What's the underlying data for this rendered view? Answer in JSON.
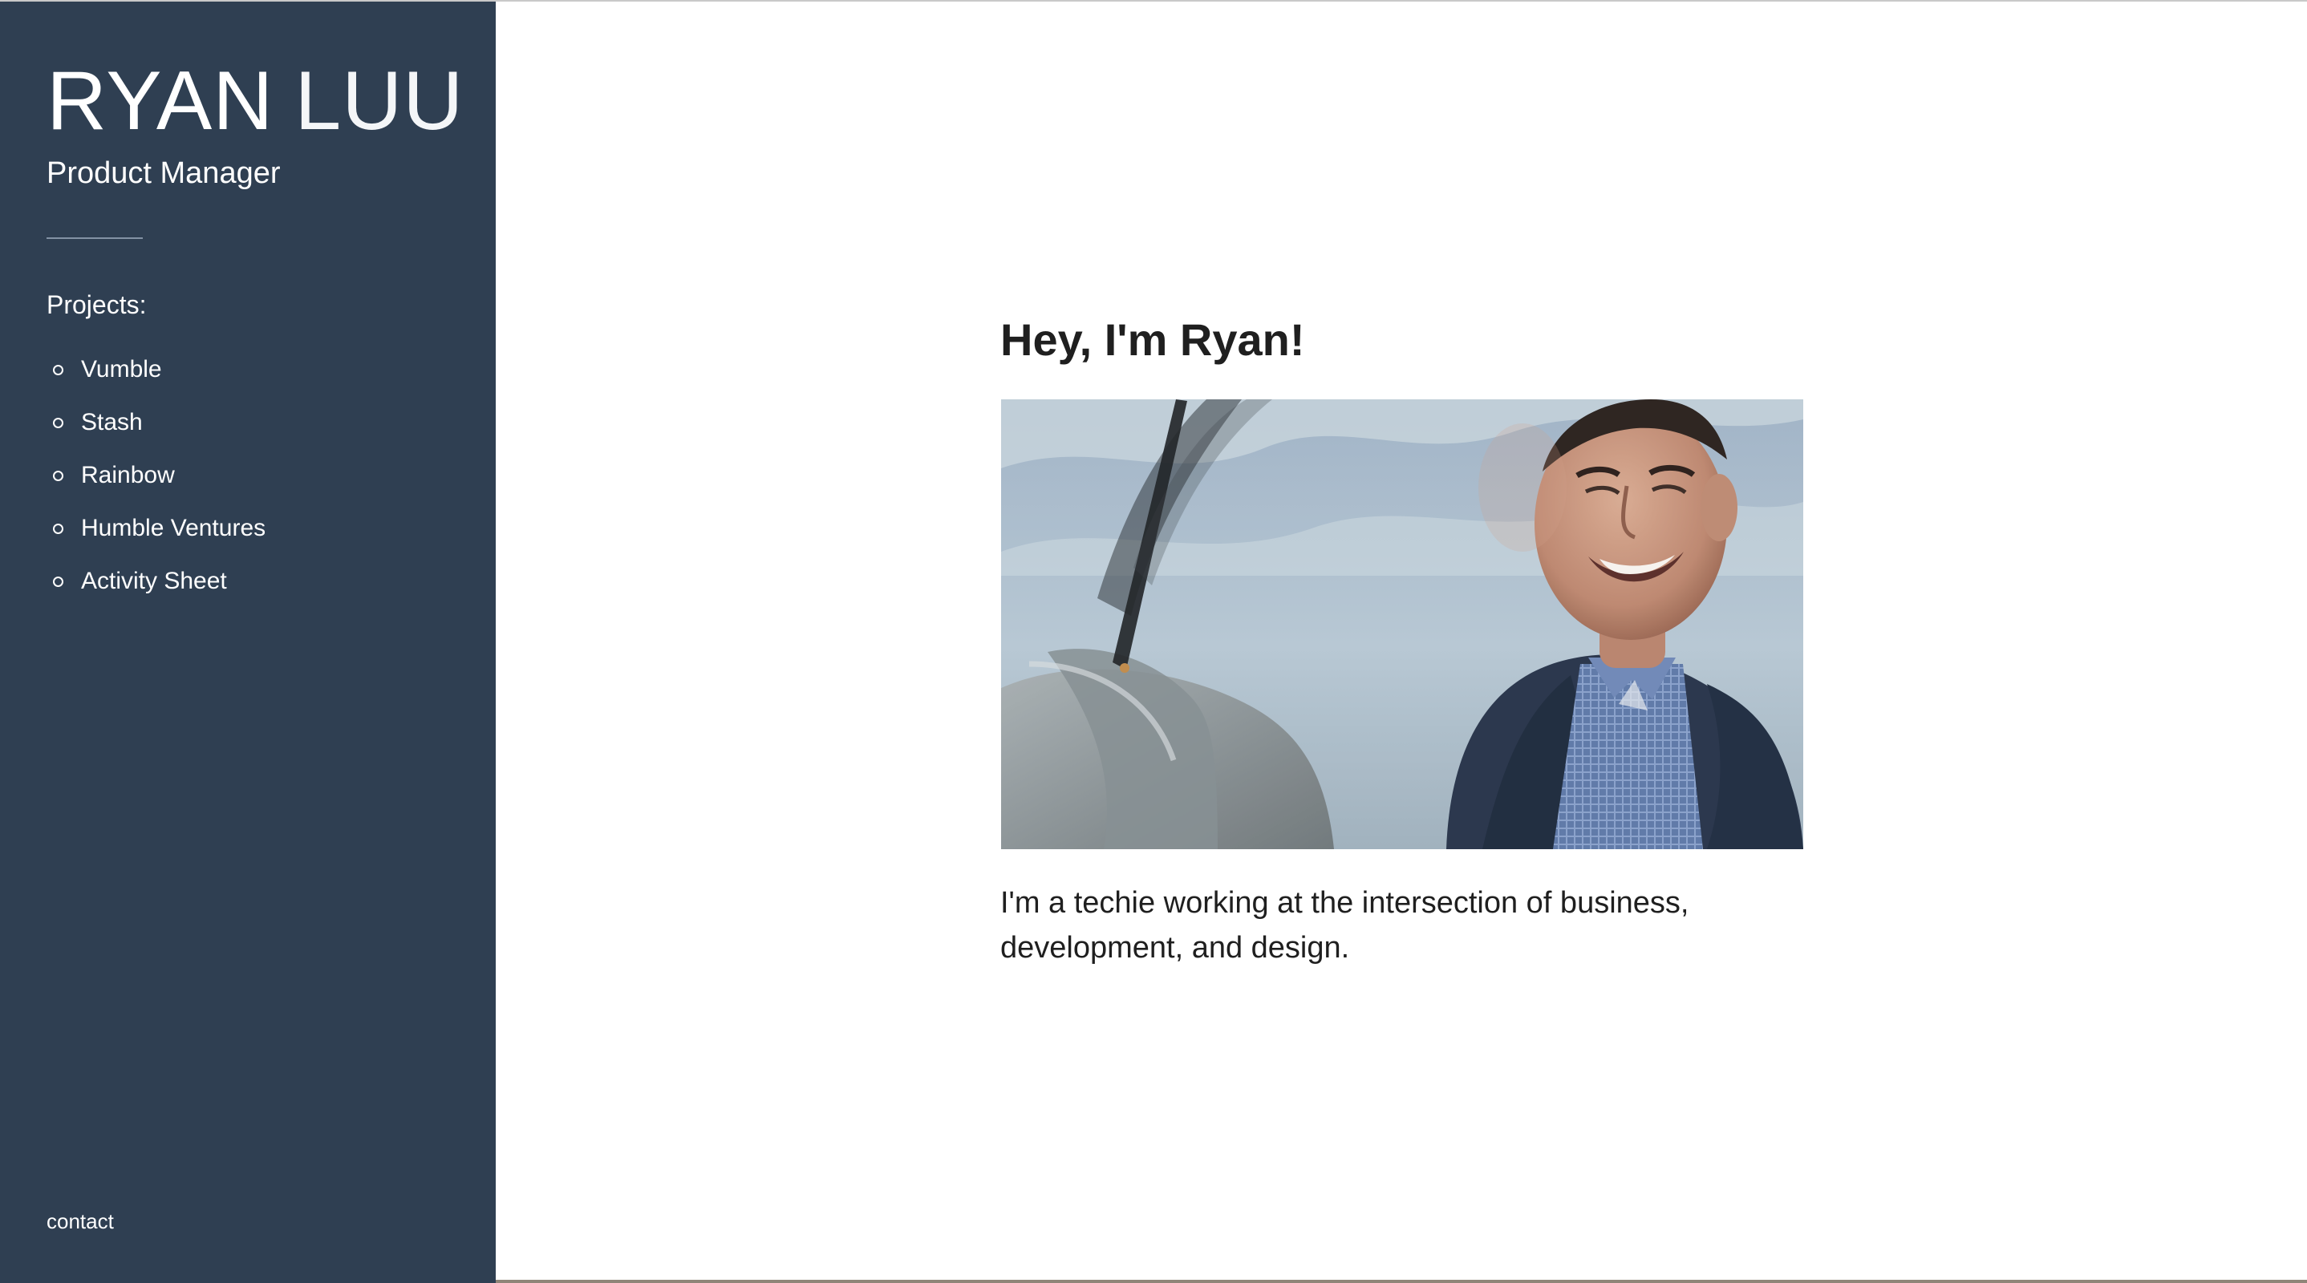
{
  "sidebar": {
    "brand_first": "RYAN",
    "brand_last": "LUU",
    "subtitle": "Product Manager",
    "projects_heading": "Projects:",
    "projects": [
      {
        "label": "Vumble"
      },
      {
        "label": "Stash"
      },
      {
        "label": "Rainbow"
      },
      {
        "label": "Humble Ventures"
      },
      {
        "label": "Activity Sheet"
      }
    ],
    "contact_label": "contact",
    "background_color": "#2f3f52"
  },
  "main": {
    "title": "Hey, I'm Ryan!",
    "intro": "I'm a techie working at the intersection of business, development, and design."
  },
  "colors": {
    "text": "#1f1f1f",
    "sidebar_text": "#ffffff",
    "divider": "#8392a4"
  }
}
